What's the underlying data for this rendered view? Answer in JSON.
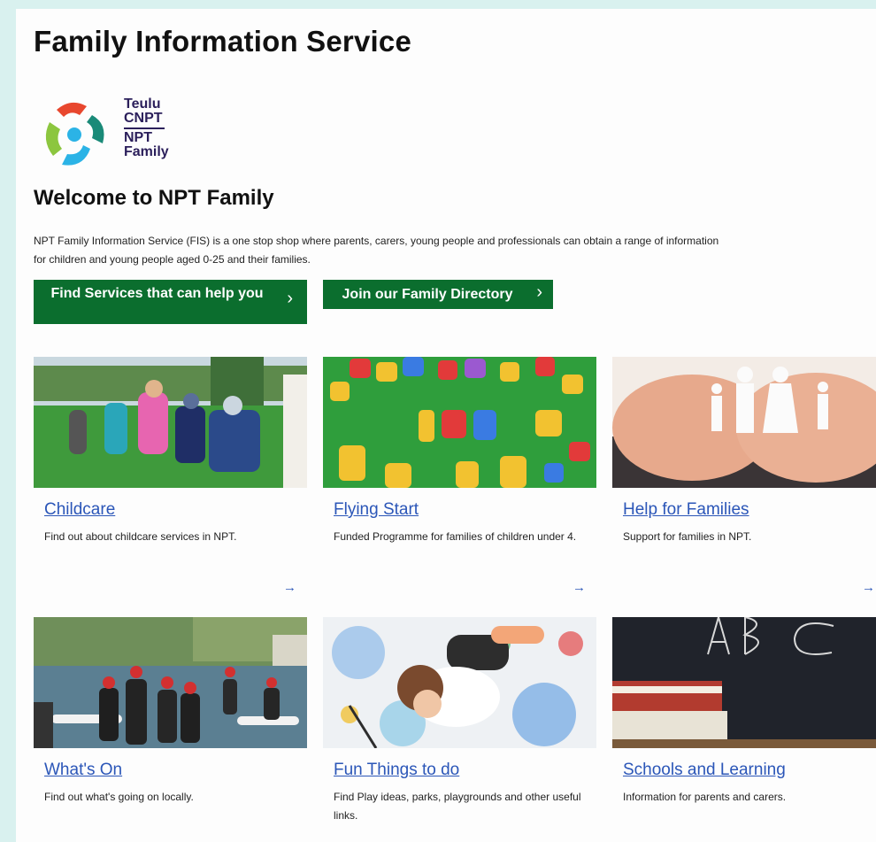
{
  "header": {
    "title": "Family Information Service"
  },
  "logo": {
    "line1": "Teulu",
    "line2": "CNPT",
    "line3": "NPT",
    "line4": "Family"
  },
  "welcome": {
    "heading": "Welcome to NPT Family"
  },
  "intro": {
    "line1": "NPT Family Information Service (FIS) is a one stop shop where parents, carers, young people and professionals can obtain a range of information",
    "line2": "for children and young people aged 0-25 and their families."
  },
  "buttons": {
    "find_services": "Find Services that can help you",
    "join_directory": "Join our Family Directory",
    "chevron": "›"
  },
  "cards": [
    {
      "title": "Childcare",
      "desc": "Find out about childcare services in NPT.",
      "arrow": "→"
    },
    {
      "title": "Flying Start",
      "desc": "Funded Programme for families of children under 4.",
      "arrow": "→"
    },
    {
      "title": "Help for Families",
      "desc": "Support for families in NPT.",
      "arrow": "→"
    },
    {
      "title": "What's On",
      "desc": "Find out what's going on locally.",
      "arrow": "→"
    },
    {
      "title": "Fun Things to do",
      "desc": "Find Play ideas, parks, playgrounds and other useful links.",
      "arrow": "→"
    },
    {
      "title": "Schools and Learning",
      "desc": "Information for parents and carers.",
      "arrow": "→"
    }
  ],
  "colors": {
    "button_green": "#0b6e2e",
    "link_blue": "#2b56b8",
    "frame": "#d9f1ef"
  }
}
